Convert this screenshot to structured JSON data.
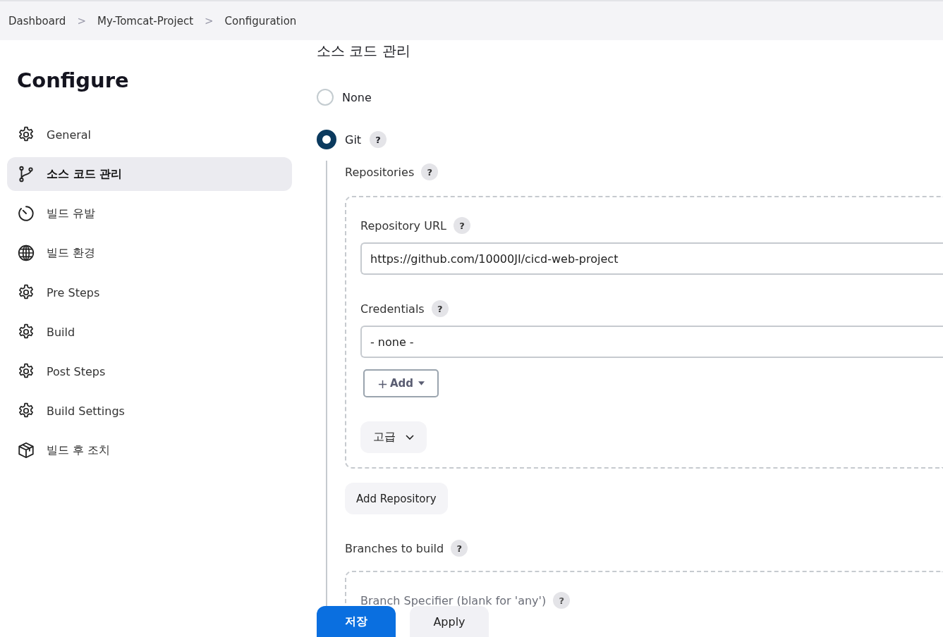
{
  "breadcrumb": [
    {
      "label": "Dashboard",
      "separator": ">"
    },
    {
      "label": "My-Tomcat-Project",
      "separator": ">"
    },
    {
      "label": "Configuration"
    }
  ],
  "sidebar": {
    "title": "Configure",
    "items": [
      {
        "label": "General",
        "selected": false
      },
      {
        "label": "소스 코드 관리",
        "selected": true
      },
      {
        "label": "빌드 유발",
        "selected": false
      },
      {
        "label": "빌드 환경",
        "selected": false
      },
      {
        "label": "Pre Steps",
        "selected": false
      },
      {
        "label": "Build",
        "selected": false
      },
      {
        "label": "Post Steps",
        "selected": false
      },
      {
        "label": "Build Settings",
        "selected": false
      },
      {
        "label": "빌드 후 조치",
        "selected": false
      }
    ]
  },
  "section": {
    "heading": "소스 코드 관리",
    "options": [
      {
        "label": "None",
        "selected": false
      },
      {
        "label": "Git",
        "selected": true,
        "help": "?"
      }
    ],
    "repositories_label": "Repositories",
    "repositories_help": "?",
    "repository_url": {
      "label": "Repository URL",
      "help": "?",
      "value": "https://github.com/10000JI/cicd-web-project"
    },
    "credentials": {
      "label": "Credentials",
      "help": "?",
      "value": "- none -"
    },
    "add_button": {
      "plus": "+",
      "label": "Add"
    },
    "advanced_button": "고급",
    "add_repository_button": "Add Repository",
    "branches_label": "Branches to build",
    "branches_help": "?",
    "branch_specifier": {
      "label": "Branch Specifier (blank for 'any')",
      "help": "?"
    }
  },
  "footer": {
    "save": "저장",
    "apply": "Apply"
  }
}
